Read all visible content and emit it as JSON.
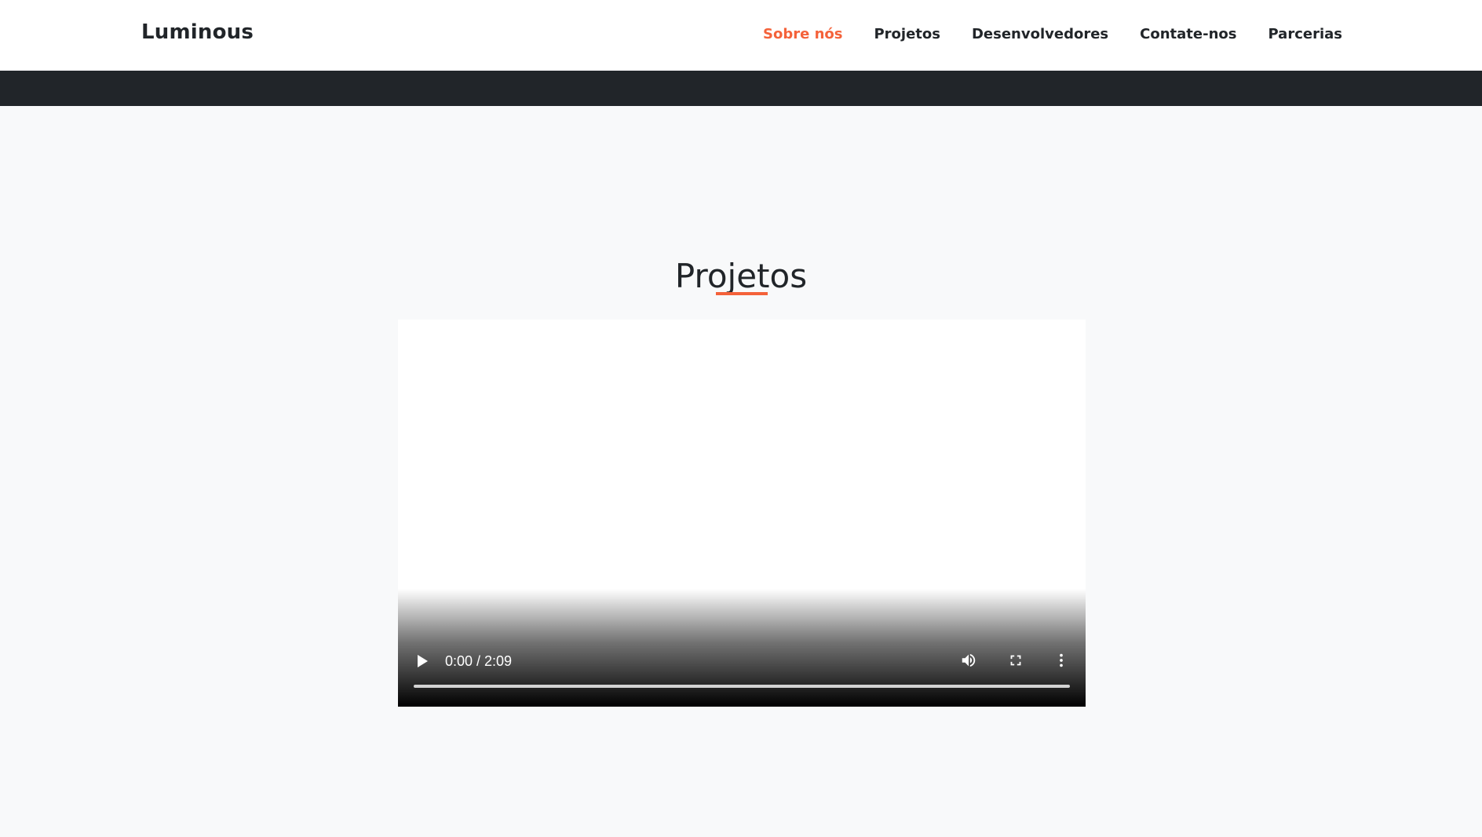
{
  "brand": "Luminous",
  "nav": {
    "items": [
      {
        "label": "Sobre nós",
        "active": true
      },
      {
        "label": "Projetos",
        "active": false
      },
      {
        "label": "Desenvolvedores",
        "active": false
      },
      {
        "label": "Contate-nos",
        "active": false
      },
      {
        "label": "Parcerias",
        "active": false
      }
    ]
  },
  "section": {
    "title": "Projetos"
  },
  "video": {
    "time": "0:00 / 2:09",
    "progress": 0,
    "icons": [
      "play-icon",
      "volume-icon",
      "fullscreen-icon",
      "more-vertical-icon"
    ]
  },
  "colors": {
    "accent": "#f4623a",
    "text": "#212529",
    "dark_band": "#212529",
    "background": "#f8f9fa"
  }
}
